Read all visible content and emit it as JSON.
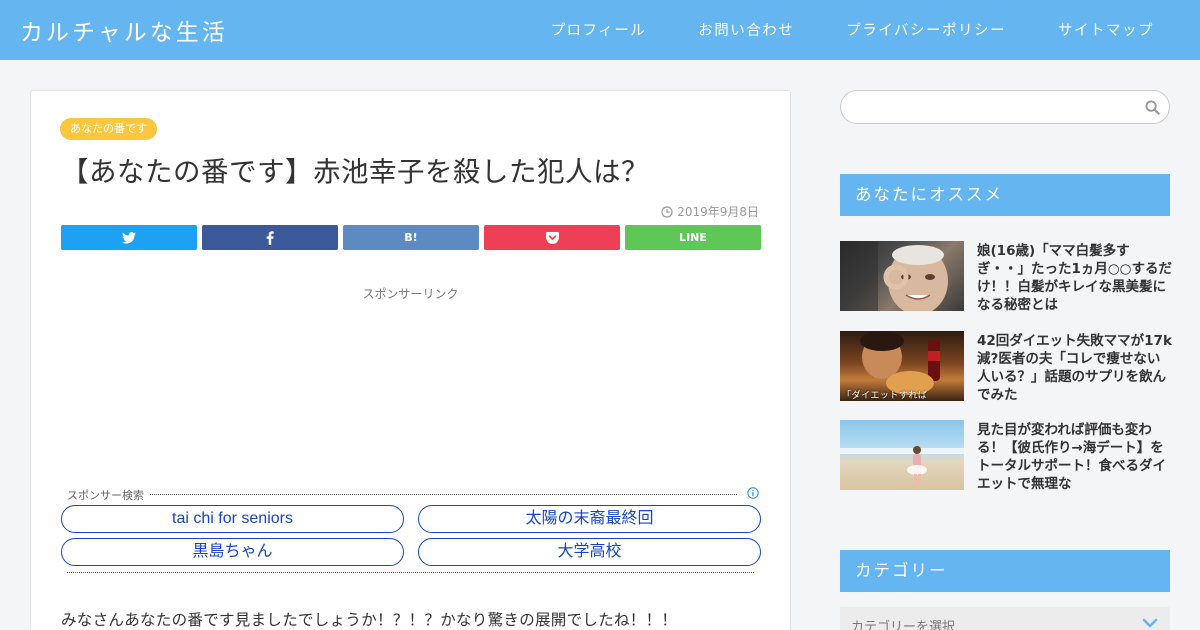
{
  "site": {
    "title": "カルチャルな生活"
  },
  "nav": {
    "items": [
      {
        "label": "プロフィール"
      },
      {
        "label": "お問い合わせ"
      },
      {
        "label": "プライバシーポリシー"
      },
      {
        "label": "サイトマップ"
      }
    ]
  },
  "article": {
    "category": "あなたの番です",
    "title": "【あなたの番です】赤池幸子を殺した犯人は？",
    "date": "2019年9月8日",
    "sponsor_label": "スポンサーリンク",
    "body_first_line": "みなさんあなたの番です見ましたでしょうか！？！？かなり驚きの展開でしたね！！！"
  },
  "share": {
    "twitter_icon": "twitter-icon",
    "facebook_icon": "facebook-icon",
    "hatena_label": "B!",
    "pocket_icon": "pocket-icon",
    "line_label": "LINE",
    "colors": {
      "twitter": "#1da1f2",
      "facebook": "#3b5998",
      "hatena": "#5d8ac1",
      "pocket": "#ef3f56",
      "line": "#5fc757"
    }
  },
  "search_ads": {
    "title": "スポンサー検索",
    "items": [
      {
        "label": "tai chi for seniors"
      },
      {
        "label": "太陽の末裔最終回"
      },
      {
        "label": "黒島ちゃん"
      },
      {
        "label": "大学高校"
      }
    ]
  },
  "sidebar": {
    "search": {
      "placeholder": "",
      "value": ""
    },
    "recommend": {
      "heading": "あなたにオススメ",
      "items": [
        {
          "title": "娘(16歳)「ママ白髪多すぎ・・」たった1ヵ月○○するだけ！！白髪がキレイな黒美髪になる秘密とは",
          "thumb_caption": ""
        },
        {
          "title": "42回ダイエット失敗ママが17k減?医者の夫「コレで痩せない人いる？」話題のサプリを飲んでみた",
          "thumb_caption": "「ダイエットすれば"
        },
        {
          "title": "見た目が変われば評価も変わる！【彼氏作り→海デート】をトータルサポート！食べるダイエットで無理な",
          "thumb_caption": ""
        }
      ]
    },
    "category": {
      "heading": "カテゴリー",
      "select_label": "カテゴリーを選択"
    }
  },
  "colors": {
    "header": "#64b5f0",
    "badge": "#fcc73f",
    "ad_link": "#1a45c4"
  }
}
